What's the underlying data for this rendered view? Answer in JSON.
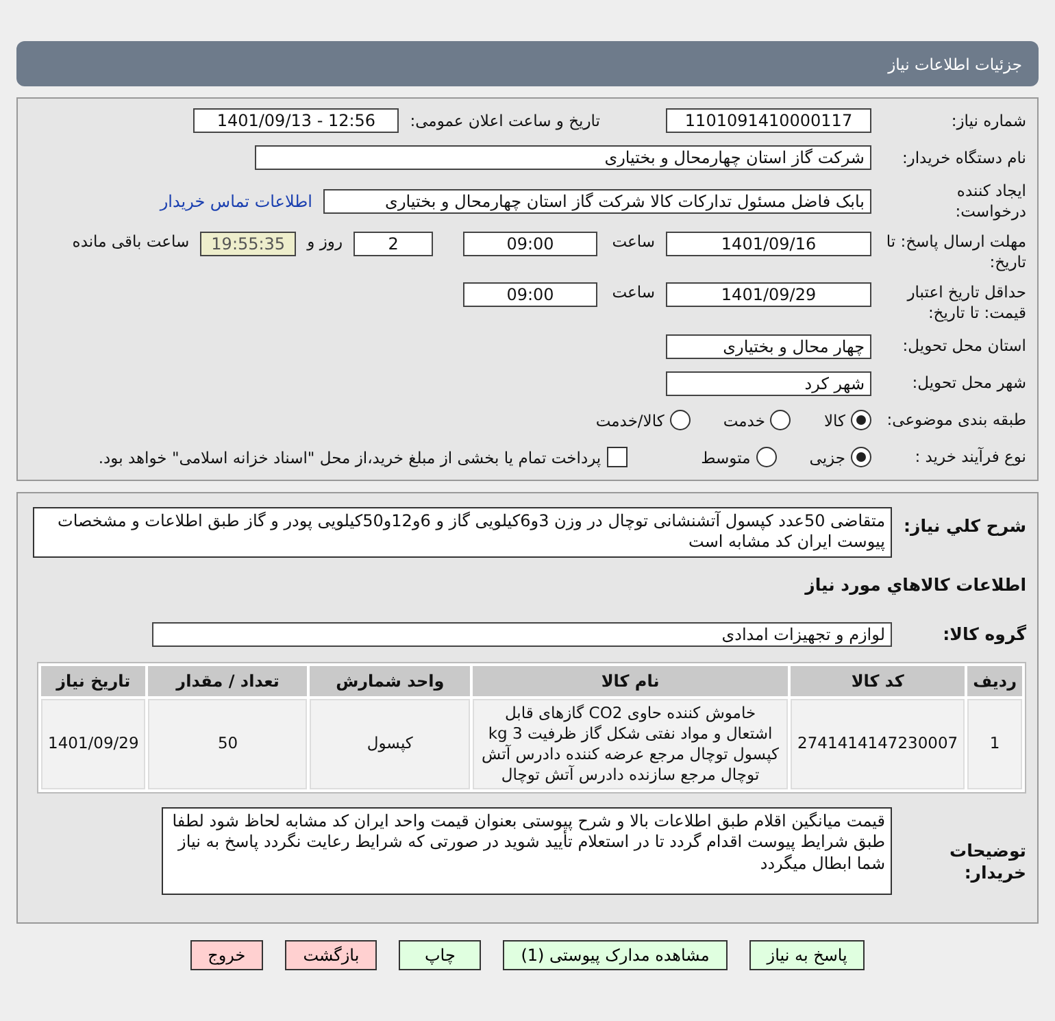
{
  "header": {
    "title": "جزئیات اطلاعات نیاز"
  },
  "need_number": {
    "label": "شماره نیاز:",
    "value": "1101091410000117"
  },
  "announce": {
    "label": "تاریخ و ساعت اعلان عمومی:",
    "value": "1401/09/13 - 12:56"
  },
  "buyer_org": {
    "label": "نام دستگاه خریدار:",
    "value": "شرکت گاز استان چهارمحال و بختیاری"
  },
  "creator": {
    "label": "ایجاد کننده درخواست:",
    "value": "بابک فاضل  مسئول تدارکات کالا شرکت گاز استان چهارمحال و بختیاری",
    "link": "اطلاعات تماس خریدار"
  },
  "deadline": {
    "label": "مهلت ارسال پاسخ: تا تاریخ:",
    "date": "1401/09/16",
    "time_label": "ساعت",
    "time": "09:00",
    "days": "2",
    "days_label": "روز و",
    "remaining": "19:55:35",
    "remaining_label": "ساعت باقی مانده"
  },
  "validity": {
    "label": "حداقل تاریخ اعتبار قیمت: تا تاریخ:",
    "date": "1401/09/29",
    "time_label": "ساعت",
    "time": "09:00"
  },
  "province": {
    "label": "استان محل تحویل:",
    "value": "چهار محال و بختیاری"
  },
  "city": {
    "label": "شهر محل تحویل:",
    "value": "شهر کرد"
  },
  "category": {
    "label": "طبقه بندی موضوعی:",
    "options": [
      {
        "label": "کالا",
        "selected": true
      },
      {
        "label": "خدمت",
        "selected": false
      },
      {
        "label": "کالا/خدمت",
        "selected": false
      }
    ]
  },
  "process": {
    "label": "نوع فرآیند خرید :",
    "options": [
      {
        "label": "جزیی",
        "selected": true
      },
      {
        "label": "متوسط",
        "selected": false
      }
    ],
    "payment": {
      "label": "پرداخت تمام یا بخشی از مبلغ خرید،از محل \"اسناد خزانه اسلامی\" خواهد بود.",
      "checked": false
    }
  },
  "summary": {
    "label": "شرح کلي نياز:",
    "value": "متقاضی 50عدد کپسول آتشنشانی توچال در وزن 3و6کیلویی گاز و 6و12و50کیلویی پودر و گاز طبق اطلاعات و مشخصات پیوست ایران کد مشابه است"
  },
  "items_heading": "اطلاعات كالاهاي مورد نياز",
  "goods_group": {
    "label": "گروه کالا:",
    "value": "لوازم و تجهیزات امدادی"
  },
  "table": {
    "columns": [
      "رديف",
      "کد کالا",
      "نام کالا",
      "واحد شمارش",
      "تعداد / مقدار",
      "تاریخ نیاز"
    ],
    "rows": [
      [
        "1",
        "2741414147230007",
        "خاموش کننده حاوی CO2 گازهای قابل اشتعال و مواد نفتی شکل گاز ظرفیت 3 kg کپسول توچال مرجع عرضه کننده دادرس آتش توچال مرجع سازنده دادرس آتش توچال",
        "کپسول",
        "50",
        "1401/09/29"
      ]
    ]
  },
  "buyer_notes": {
    "label": "توضیحات خریدار:",
    "value": "قیمت میانگین اقلام طبق اطلاعات بالا و شرح پیوستی بعنوان قیمت واحد ایران کد مشابه لحاظ شود لطفا طبق شرایط پیوست اقدام گردد تا در استعلام تأیید شوید در صورتی که شرایط رعایت نگردد پاسخ به نیاز شما ابطال میگردد"
  },
  "buttons": [
    {
      "label": "پاسخ به نیاز",
      "kind": "primary"
    },
    {
      "label": "مشاهده مدارک پیوستی (1)",
      "kind": "primary"
    },
    {
      "label": "چاپ",
      "kind": "primary"
    },
    {
      "label": "بازگشت",
      "kind": "danger"
    },
    {
      "label": "خروج",
      "kind": "danger"
    }
  ]
}
